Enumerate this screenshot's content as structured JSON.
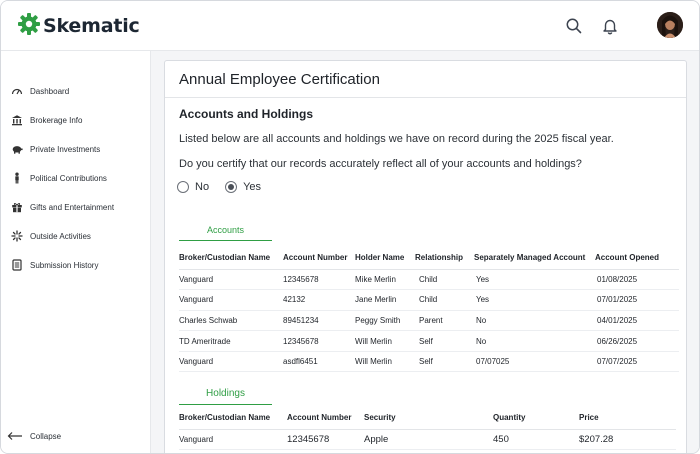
{
  "brand": {
    "name": "Skematic",
    "color": "#2f9e44"
  },
  "header": {
    "icons": [
      "search-icon",
      "bell-icon"
    ],
    "avatar": "user-avatar"
  },
  "sidebar": {
    "items": [
      {
        "label": "Dashboard",
        "icon": "gauge-icon"
      },
      {
        "label": "Brokerage Info",
        "icon": "bank-icon"
      },
      {
        "label": "Private Investments",
        "icon": "piggy-bank-icon"
      },
      {
        "label": "Political Contributions",
        "icon": "person-icon"
      },
      {
        "label": "Gifts and Entertainment",
        "icon": "gift-icon"
      },
      {
        "label": "Outside Activities",
        "icon": "sparkle-icon"
      },
      {
        "label": "Submission History",
        "icon": "history-icon"
      }
    ],
    "collapse_label": "Collapse"
  },
  "card": {
    "title": "Annual Employee Certification",
    "section_title": "Accounts and Holdings",
    "intro": "Listed below are all accounts and holdings we have on record during the 2025 fiscal year.",
    "question": "Do you certify that our records accurately reflect all of your accounts and holdings?",
    "options": [
      {
        "label": "No",
        "selected": false
      },
      {
        "label": "Yes",
        "selected": true
      }
    ]
  },
  "accounts": {
    "tab_label": "Accounts",
    "columns": [
      "Broker/Custodian Name",
      "Account Number",
      "Holder Name",
      "Relationship",
      "Separately Managed Account",
      "Account Opened"
    ],
    "rows": [
      [
        "Vanguard",
        "12345678",
        "Mike Merlin",
        "Child",
        "Yes",
        "01/08/2025"
      ],
      [
        "Vanguard",
        "42132",
        "Jane Merlin",
        "Child",
        "Yes",
        "07/01/2025"
      ],
      [
        "Charles Schwab",
        "89451234",
        "Peggy Smith",
        "Parent",
        "No",
        "04/01/2025"
      ],
      [
        "TD Ameritrade",
        "12345678",
        "Will Merlin",
        "Self",
        "No",
        "06/26/2025"
      ],
      [
        "Vanguard",
        "asdfl6451",
        "Will Merlin",
        "Self",
        "07/07025",
        "07/07/2025"
      ]
    ]
  },
  "holdings": {
    "tab_label": "Holdings",
    "columns": [
      "Broker/Custodian Name",
      "Account Number",
      "Security",
      "Quantity",
      "Price"
    ],
    "rows": [
      [
        "Vanguard",
        "12345678",
        "Apple",
        "450",
        "$207.28"
      ]
    ]
  }
}
